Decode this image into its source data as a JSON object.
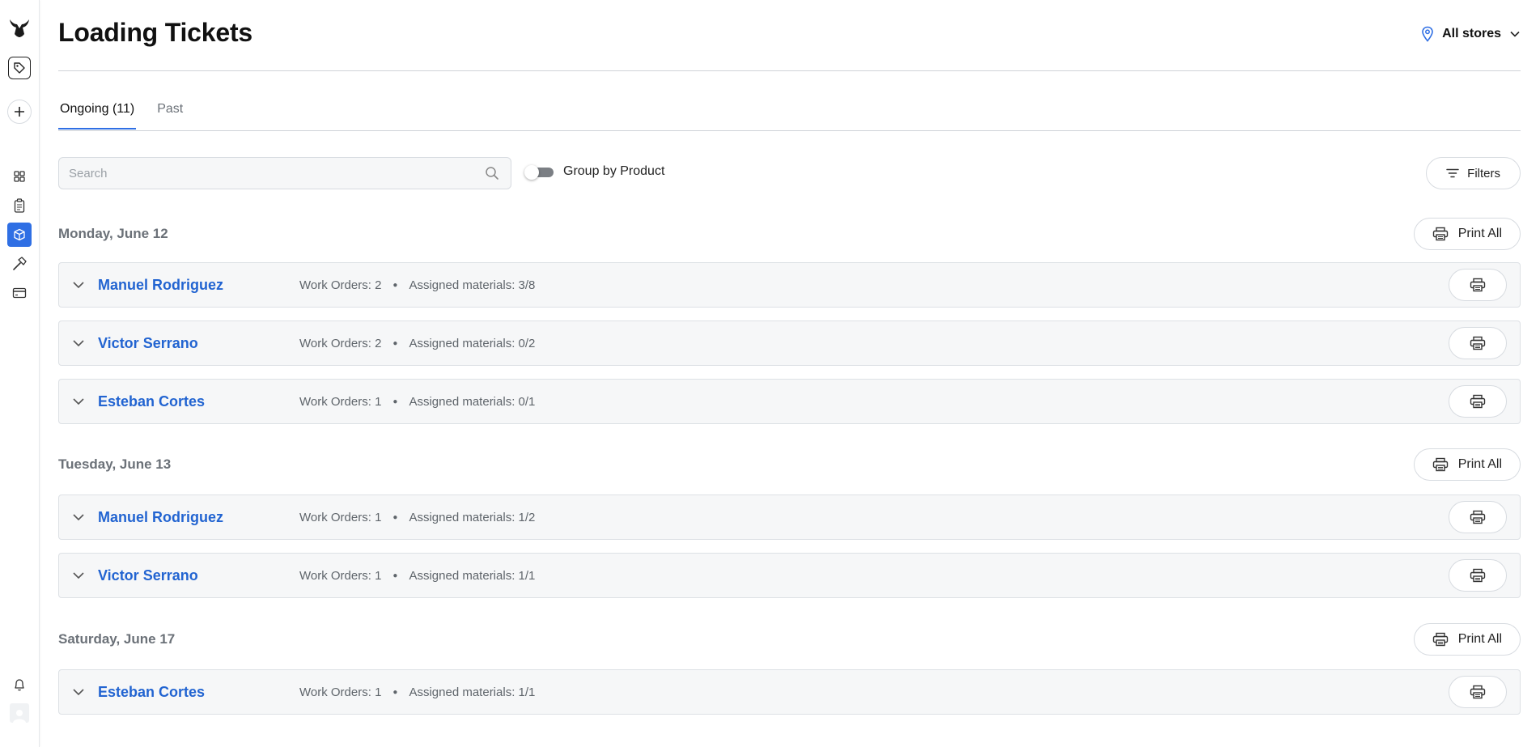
{
  "sidebar": {
    "icons": [
      "logo-icon",
      "tag-icon",
      "plus-icon",
      "grid-icon",
      "clipboard-icon",
      "box-icon",
      "hammer-icon",
      "card-icon",
      "bell-icon",
      "avatar-icon"
    ],
    "active": "box-icon",
    "accent": "#2f6fe4"
  },
  "header": {
    "title": "Loading Tickets",
    "store_selector": "All stores"
  },
  "tabs": [
    {
      "label": "Ongoing (11)",
      "active": true
    },
    {
      "label": "Past",
      "active": false
    }
  ],
  "toolbar": {
    "search_placeholder": "Search",
    "group_label": "Group by Product",
    "group_enabled": false,
    "filters_label": "Filters"
  },
  "days": [
    {
      "title": "Monday, June 12",
      "print_all": "Print All",
      "rows": [
        {
          "name": "Manuel Rodriguez",
          "work_orders": "Work Orders: 2",
          "materials": "Assigned materials: 3/8"
        },
        {
          "name": "Victor Serrano",
          "work_orders": "Work Orders: 2",
          "materials": "Assigned materials: 0/2"
        },
        {
          "name": "Esteban Cortes",
          "work_orders": "Work Orders: 1",
          "materials": "Assigned materials: 0/1"
        }
      ]
    },
    {
      "title": "Tuesday, June 13",
      "print_all": "Print All",
      "rows": [
        {
          "name": "Manuel Rodriguez",
          "work_orders": "Work Orders: 1",
          "materials": "Assigned materials: 1/2"
        },
        {
          "name": "Victor Serrano",
          "work_orders": "Work Orders: 1",
          "materials": "Assigned materials: 1/1"
        }
      ]
    },
    {
      "title": "Saturday, June 17",
      "print_all": "Print All",
      "rows": [
        {
          "name": "Esteban Cortes",
          "work_orders": "Work Orders: 1",
          "materials": "Assigned materials: 1/1"
        }
      ]
    }
  ],
  "colors": {
    "link": "#2264d1",
    "accent": "#2f6fe4",
    "row_bg": "#f6f7f8"
  }
}
